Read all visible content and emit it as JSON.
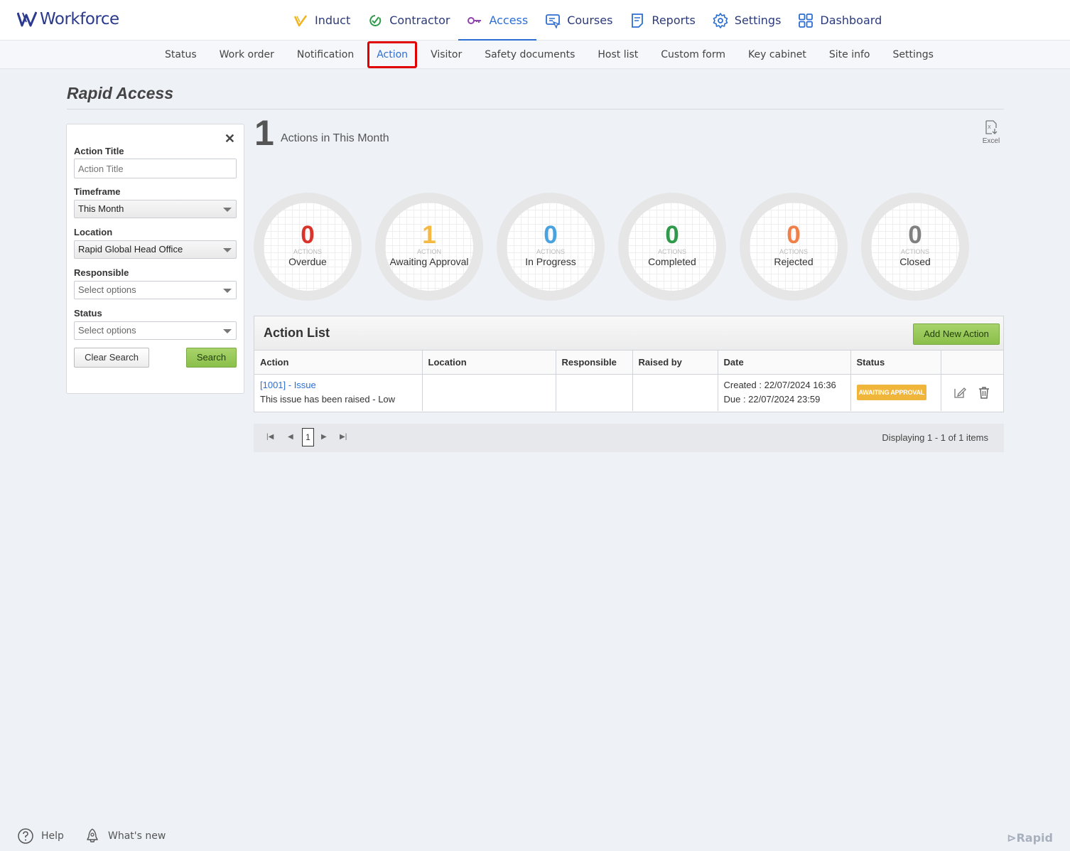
{
  "app": {
    "name": "Workforce"
  },
  "main_nav": [
    {
      "label": "Induct",
      "icon": "induct-icon",
      "color": "#f0b41e"
    },
    {
      "label": "Contractor",
      "icon": "contractor-icon",
      "color": "#2e9a4a"
    },
    {
      "label": "Access",
      "icon": "access-key-icon",
      "color": "#8e44ad",
      "active": true
    },
    {
      "label": "Courses",
      "icon": "courses-icon",
      "color": "#2d6ed3"
    },
    {
      "label": "Reports",
      "icon": "reports-icon",
      "color": "#2d6ed3"
    },
    {
      "label": "Settings",
      "icon": "gear-icon",
      "color": "#2d6ed3"
    },
    {
      "label": "Dashboard",
      "icon": "dashboard-grid-icon",
      "color": "#2d6ed3"
    }
  ],
  "sub_nav": [
    {
      "label": "Status"
    },
    {
      "label": "Work order"
    },
    {
      "label": "Notification"
    },
    {
      "label": "Action",
      "active": true
    },
    {
      "label": "Visitor"
    },
    {
      "label": "Safety documents"
    },
    {
      "label": "Host list"
    },
    {
      "label": "Custom form"
    },
    {
      "label": "Key cabinet"
    },
    {
      "label": "Site info"
    },
    {
      "label": "Settings"
    }
  ],
  "page": {
    "title": "Rapid Access"
  },
  "filter": {
    "close": "✕",
    "action_title_label": "Action Title",
    "action_title_placeholder": "Action Title",
    "timeframe_label": "Timeframe",
    "timeframe_value": "This Month",
    "location_label": "Location",
    "location_value": "Rapid Global Head Office",
    "responsible_label": "Responsible",
    "responsible_placeholder": "Select options",
    "status_label": "Status",
    "status_placeholder": "Select options",
    "clear_label": "Clear Search",
    "search_label": "Search"
  },
  "summary": {
    "count": "1",
    "label": "Actions in This Month",
    "excel_label": "Excel"
  },
  "stats": [
    {
      "value": "0",
      "caption": "ACTIONS",
      "label": "Overdue",
      "color": "#d9342b"
    },
    {
      "value": "1",
      "caption": "ACTION",
      "label": "Awaiting Approval",
      "color": "#f5b942"
    },
    {
      "value": "0",
      "caption": "ACTIONS",
      "label": "In Progress",
      "color": "#4aa3df"
    },
    {
      "value": "0",
      "caption": "ACTIONS",
      "label": "Completed",
      "color": "#2e9a4a"
    },
    {
      "value": "0",
      "caption": "ACTIONS",
      "label": "Rejected",
      "color": "#f0804a"
    },
    {
      "value": "0",
      "caption": "ACTIONS",
      "label": "Closed",
      "color": "#808080"
    }
  ],
  "action_list": {
    "title": "Action List",
    "add_label": "Add New Action",
    "columns": [
      "Action",
      "Location",
      "Responsible",
      "Raised by",
      "Date",
      "Status",
      ""
    ],
    "rows": [
      {
        "id_link": "[1001] - Issue",
        "description": "This issue has been raised - Low",
        "location": "",
        "responsible": "",
        "raised_by": "",
        "created": "Created : 22/07/2024 16:36",
        "due": "Due : 22/07/2024 23:59",
        "status": "AWAITING APPROVAL"
      }
    ]
  },
  "pager": {
    "page": "1",
    "info": "Displaying 1 - 1 of 1 items"
  },
  "footer": {
    "help": "Help",
    "whats_new": "What's new",
    "brand": "Rapid"
  }
}
